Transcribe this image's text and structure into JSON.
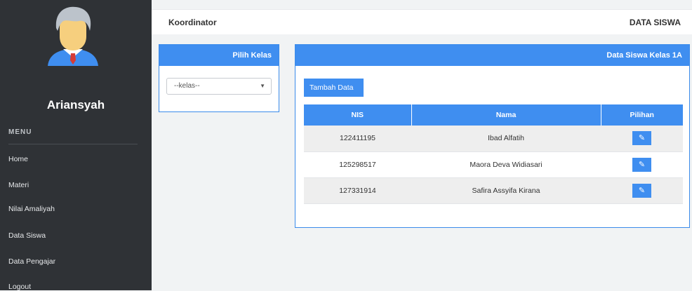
{
  "sidebar": {
    "username": "Ariansyah",
    "menu_heading": "MENU",
    "items": [
      {
        "label": "Home"
      },
      {
        "label": "Materi"
      },
      {
        "label": "Nilai Amaliyah"
      },
      {
        "label": "Data Siswa"
      },
      {
        "label": "Data Pengajar"
      },
      {
        "label": "Logout"
      }
    ]
  },
  "header": {
    "left_title": "Koordinator",
    "right_title": "DATA SISWA"
  },
  "class_panel": {
    "title": "Pilih Kelas",
    "select_value": "--kelas--"
  },
  "student_panel": {
    "title": "Data Siswa Kelas 1A",
    "add_button": "Tambah Data",
    "columns": [
      "NIS",
      "Nama",
      "Pilihan"
    ],
    "rows": [
      {
        "nis": "122411195",
        "nama": "Ibad Alfatih"
      },
      {
        "nis": "125298517",
        "nama": "Maora Deva Widiasari"
      },
      {
        "nis": "127331914",
        "nama": "Safira Assyifa Kirana"
      }
    ]
  },
  "colors": {
    "sidebar": "#2f3236",
    "accent": "#3f8ef0"
  }
}
